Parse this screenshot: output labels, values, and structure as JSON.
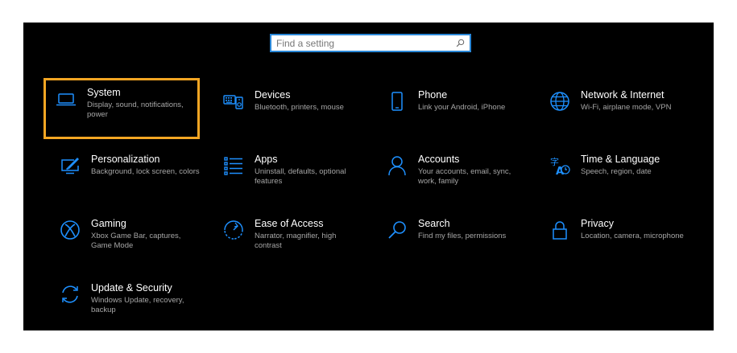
{
  "search": {
    "placeholder": "Find a setting",
    "icon": "search-icon"
  },
  "colors": {
    "accent": "#2b88d8",
    "highlight": "#f5a623",
    "icon": "#1e90ff",
    "background": "#000000"
  },
  "tiles": [
    {
      "title": "System",
      "desc": "Display, sound, notifications, power",
      "icon": "laptop-icon",
      "selected": true
    },
    {
      "title": "Devices",
      "desc": "Bluetooth, printers, mouse",
      "icon": "keyboard-speaker-icon"
    },
    {
      "title": "Phone",
      "desc": "Link your Android, iPhone",
      "icon": "phone-icon"
    },
    {
      "title": "Network & Internet",
      "desc": "Wi-Fi, airplane mode, VPN",
      "icon": "globe-icon"
    },
    {
      "title": "Personalization",
      "desc": "Background, lock screen, colors",
      "icon": "paint-monitor-icon"
    },
    {
      "title": "Apps",
      "desc": "Uninstall, defaults, optional features",
      "icon": "apps-list-icon"
    },
    {
      "title": "Accounts",
      "desc": "Your accounts, email, sync, work, family",
      "icon": "person-icon"
    },
    {
      "title": "Time & Language",
      "desc": "Speech, region, date",
      "icon": "time-language-icon"
    },
    {
      "title": "Gaming",
      "desc": "Xbox Game Bar, captures, Game Mode",
      "icon": "xbox-icon"
    },
    {
      "title": "Ease of Access",
      "desc": "Narrator, magnifier, high contrast",
      "icon": "ease-of-access-icon"
    },
    {
      "title": "Search",
      "desc": "Find my files, permissions",
      "icon": "magnifier-icon"
    },
    {
      "title": "Privacy",
      "desc": "Location, camera, microphone",
      "icon": "lock-icon"
    },
    {
      "title": "Update & Security",
      "desc": "Windows Update, recovery, backup",
      "icon": "sync-arrows-icon"
    }
  ]
}
